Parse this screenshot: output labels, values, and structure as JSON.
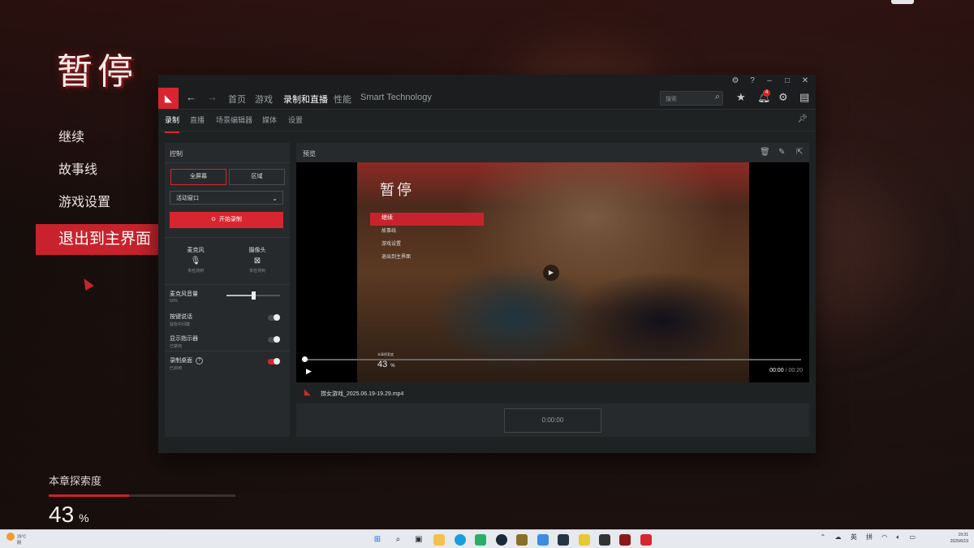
{
  "game": {
    "pause_title": "暂停",
    "menu": [
      "继续",
      "故事线",
      "游戏设置",
      "退出到主界面"
    ],
    "active_index": 3,
    "explore_label": "本章探索度",
    "explore_value": "43",
    "explore_unit": "%",
    "explore_fraction": 0.43
  },
  "window": {
    "controls": [
      "bug-icon",
      "help-icon",
      "minimize-icon",
      "maximize-icon",
      "close-icon"
    ],
    "logo": "AMD",
    "nav": [
      "首页",
      "游戏",
      "录制和直播",
      "性能",
      "Smart Technology"
    ],
    "nav_active": 2,
    "search_placeholder": "搜索",
    "notification_count": "4",
    "subnav": [
      "录制",
      "直播",
      "场景编辑器",
      "媒体",
      "设置"
    ],
    "subnav_active": 0
  },
  "control": {
    "title": "控制",
    "mode_full": "全屏幕",
    "mode_region": "区域",
    "window_select": "活动窗口",
    "start_record": "开始录制",
    "mic_label": "麦克风",
    "mic_status": "未检测到",
    "camera_label": "摄像头",
    "camera_status": "未检测到",
    "mic_volume_label": "麦克风音量",
    "mic_volume_value": "50%",
    "mic_volume_fraction": 0.5,
    "push_to_talk_label": "按键说话",
    "push_to_talk_status": "鼠标中间键",
    "show_indicator_label": "显示指示器",
    "show_indicator_status": "已禁用",
    "record_desktop_label": "录制桌面",
    "record_desktop_status": "已启用"
  },
  "preview": {
    "title": "预览",
    "frame_title": "暂停",
    "frame_menu": [
      "继续",
      "故事线",
      "游戏设置",
      "退出到主界面"
    ],
    "frame_explore_label": "本章探索度",
    "frame_explore_value": "43",
    "frame_explore_unit": "%",
    "time_current": "00:00",
    "time_sep": "/",
    "time_total": "00:20",
    "filename": "捞女游戏_2025.06.19-19.29.mp4",
    "record_time": "0:00:00"
  },
  "taskbar": {
    "weather_temp": "25°C",
    "weather_desc": "阴",
    "weather_badge": "1",
    "ime_lang": "英",
    "ime_mode": "拼",
    "time": "19:31",
    "date": "2025/6/19"
  },
  "colors": {
    "accent": "#d7262f",
    "game_red": "#c8232c"
  }
}
